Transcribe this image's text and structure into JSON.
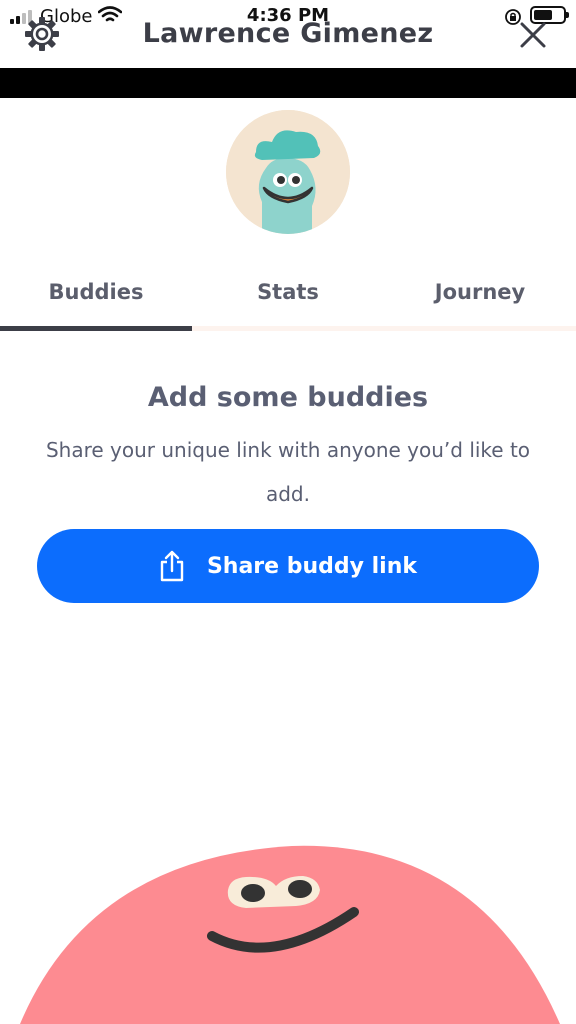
{
  "status_bar": {
    "carrier": "Globe",
    "time": "4:36 PM",
    "icons": [
      "signal-icon",
      "wifi-icon",
      "rotation-lock-icon",
      "battery-icon"
    ]
  },
  "header": {
    "title": "Lawrence Gimenez",
    "left_icon": "gear-icon",
    "right_icon": "close-icon"
  },
  "profile": {
    "avatar": "character-avatar",
    "avatar_colors": {
      "background": "#f4e4d0",
      "character": "#8ed3cc",
      "hat": "#52c1b8",
      "smile": "#e6873a"
    }
  },
  "tabs": {
    "items": [
      {
        "label": "Buddies",
        "active": true
      },
      {
        "label": "Stats",
        "active": false
      },
      {
        "label": "Journey",
        "active": false
      }
    ]
  },
  "empty_state": {
    "title": "Add some buddies",
    "description": "Share your unique link with anyone you’d like to add."
  },
  "share_button": {
    "label": "Share buddy link",
    "icon": "share-icon",
    "color": "#0c6dfd"
  },
  "decoration": {
    "character": "pink-blob-character",
    "color": "#fd8b91"
  }
}
